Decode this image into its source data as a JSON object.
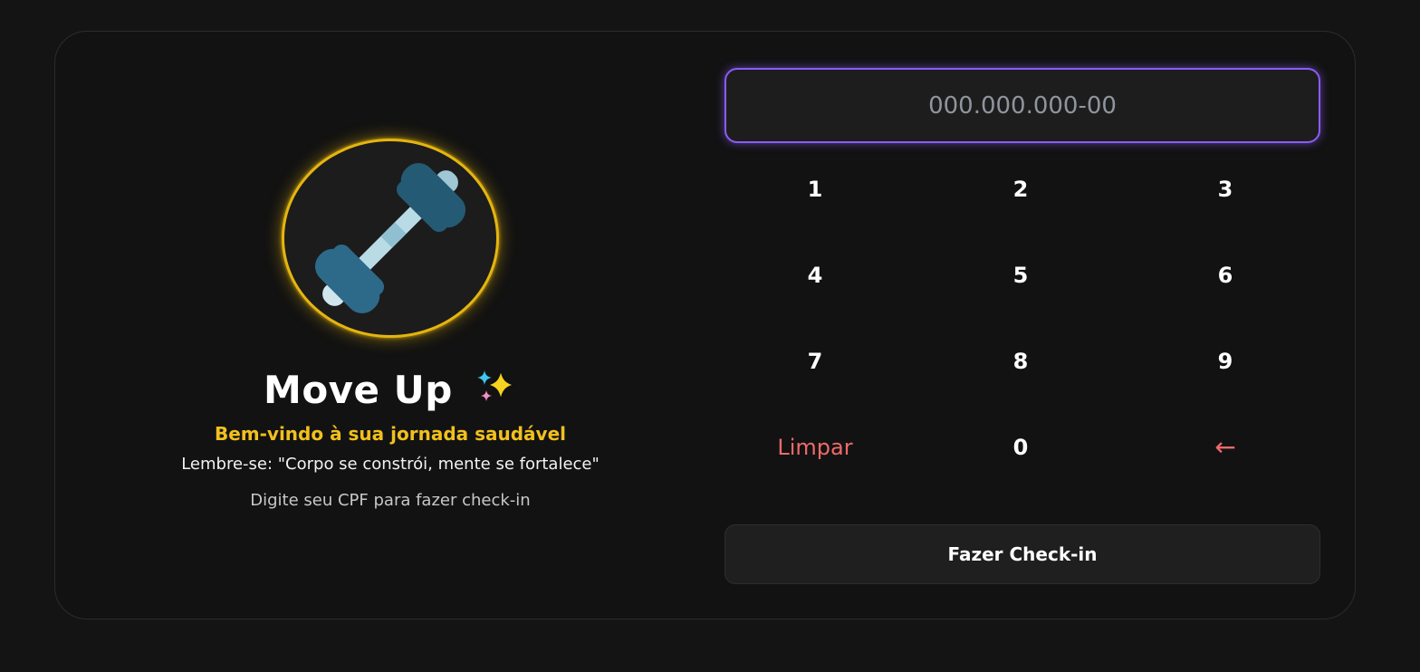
{
  "brand": {
    "title": "Move Up",
    "title_emoji_icon": "sparkles-icon",
    "logo_icon": "dumbbell-icon",
    "accent_color": "#e5b50f"
  },
  "welcome": {
    "subtitle": "Bem-vindo à sua jornada saudável",
    "quote": "Lembre-se: \"Corpo se constrói, mente se fortalece\"",
    "hint": "Digite seu CPF para fazer check-in"
  },
  "cpf": {
    "value": "",
    "placeholder": "000.000.000-00",
    "focus_color": "#8a5cf6"
  },
  "keypad": {
    "keys": [
      "1",
      "2",
      "3",
      "4",
      "5",
      "6",
      "7",
      "8",
      "9"
    ],
    "clear_label": "Limpar",
    "zero_label": "0",
    "backspace_label": "←",
    "danger_color": "#f06a6a"
  },
  "actions": {
    "checkin_label": "Fazer Check-in"
  }
}
